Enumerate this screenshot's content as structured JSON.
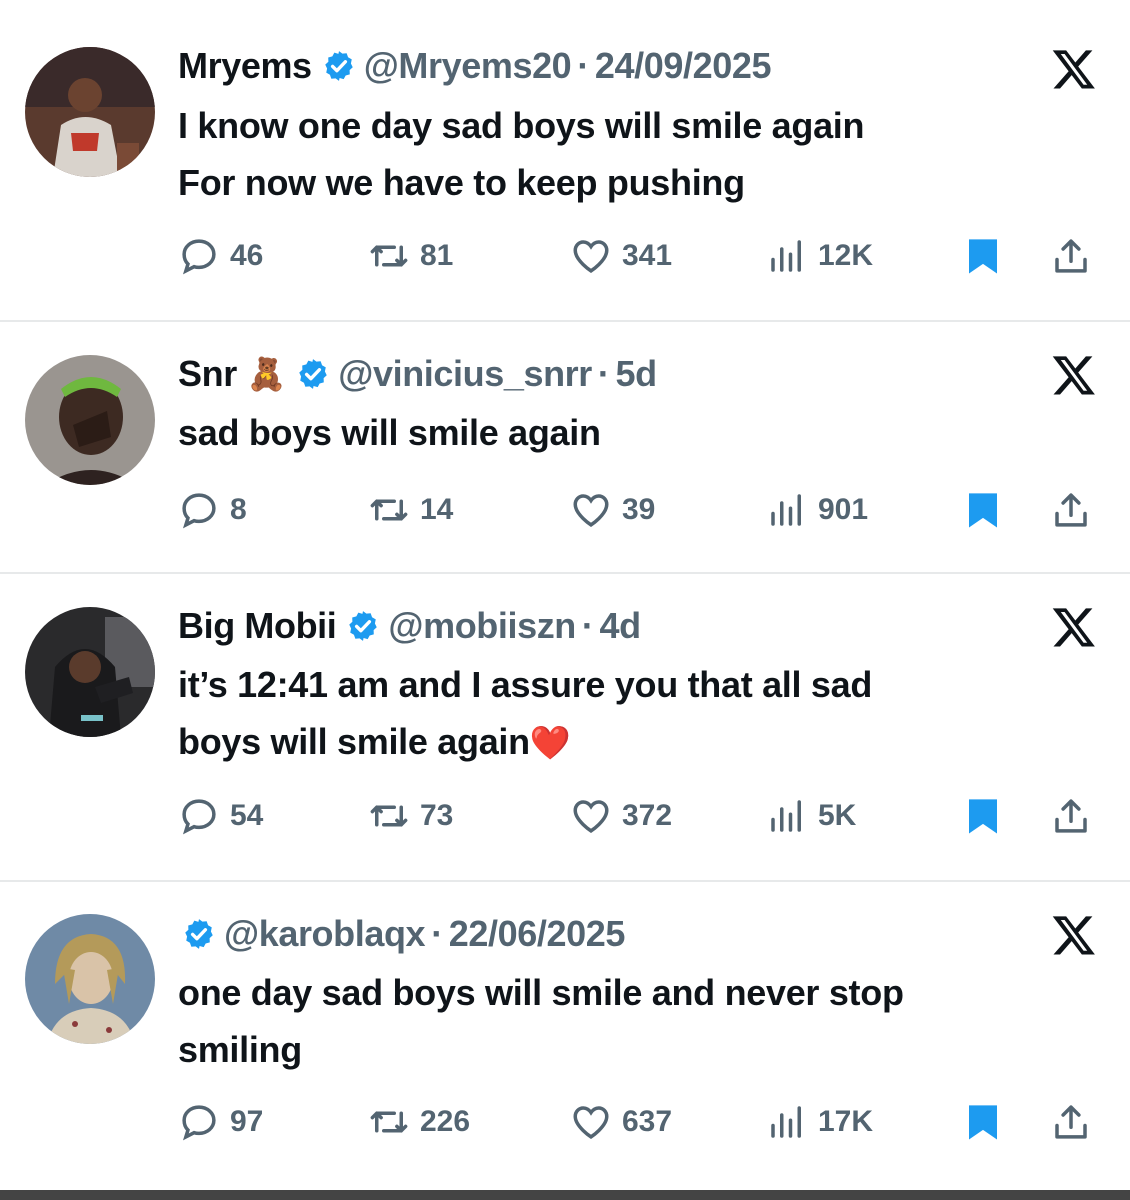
{
  "tweets": [
    {
      "name": "Mryems",
      "handle": "@Mryems20",
      "separator": "·",
      "date": "24/09/2025",
      "emoji": "",
      "lines": [
        "I know one day sad boys will smile again",
        "For now we have to keep pushing"
      ],
      "heart": "",
      "replies": "46",
      "retweets": "81",
      "likes": "341",
      "views": "12K"
    },
    {
      "name": "Snr",
      "handle": "@vinicius_snrr",
      "separator": "·",
      "date": "5d",
      "emoji": "🧸",
      "lines": [
        "sad boys will smile again"
      ],
      "heart": "",
      "replies": "8",
      "retweets": "14",
      "likes": "39",
      "views": "901"
    },
    {
      "name": "Big Mobii",
      "handle": "@mobiiszn",
      "separator": "·",
      "date": "4d",
      "emoji": "",
      "lines": [
        "it’s 12:41 am and I assure you that all sad",
        "boys will smile again"
      ],
      "heart": "❤️",
      "replies": "54",
      "retweets": "73",
      "likes": "372",
      "views": "5K"
    },
    {
      "name": "",
      "handle": "@karoblaqx",
      "separator": "·",
      "date": "22/06/2025",
      "emoji": "",
      "lines": [
        "one day sad boys will smile and never stop",
        "smiling"
      ],
      "heart": "",
      "replies": "97",
      "retweets": "226",
      "likes": "637",
      "views": "17K"
    }
  ],
  "colors": {
    "verified": "#1d9bf0",
    "muted_text": "#536471",
    "text": "#0f1419",
    "bookmark_active": "#1d9bf0",
    "divider": "#e7e9ea"
  },
  "icons": {
    "reply": "reply-icon",
    "retweet": "retweet-icon",
    "like": "like-icon",
    "views": "views-icon",
    "bookmark": "bookmark-icon",
    "share": "share-icon",
    "brand": "x-logo-icon",
    "verified": "verified-badge-icon"
  }
}
